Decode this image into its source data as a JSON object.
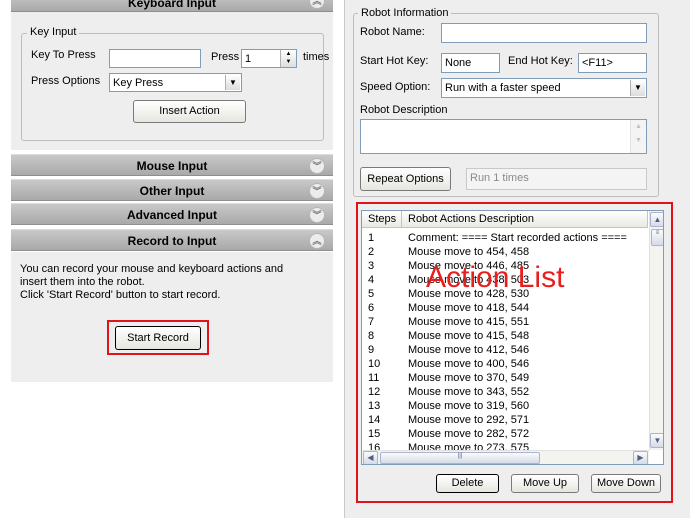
{
  "left": {
    "keyboard_header": "Keyboard Input",
    "key_input": {
      "legend": "Key Input",
      "key_to_press_label": "Key To Press",
      "key_to_press_value": "",
      "press_label": "Press",
      "press_value": "1",
      "times_label": "times",
      "press_options_label": "Press Options",
      "press_options_value": "Key Press",
      "insert_action_label": "Insert Action"
    },
    "mouse_header": "Mouse Input",
    "other_header": "Other Input",
    "advanced_header": "Advanced Input",
    "record_header": "Record to Input",
    "record_text_1": "You can record your mouse and keyboard actions and",
    "record_text_2": "insert them into the robot.",
    "record_text_3": "Click 'Start Record' button to start record.",
    "start_record_label": "Start Record"
  },
  "right": {
    "robot_info_legend": "Robot Information",
    "robot_name_label": "Robot Name:",
    "robot_name_value": "",
    "start_hot_key_label": "Start Hot Key:",
    "start_hot_key_value": "None",
    "end_hot_key_label": "End Hot Key:",
    "end_hot_key_value": "<F11>",
    "speed_option_label": "Speed Option:",
    "speed_option_value": "Run with a faster speed",
    "robot_description_label": "Robot Description",
    "robot_description_value": "",
    "repeat_options_label": "Repeat Options",
    "repeat_value": "Run 1 times"
  },
  "actions": {
    "overlay_label": "Action List",
    "col_steps": "Steps",
    "col_desc": "Robot Actions Description",
    "rows": [
      {
        "step": "1",
        "desc": "Comment: ==== Start recorded actions ===="
      },
      {
        "step": "2",
        "desc": "Mouse move to 454, 458"
      },
      {
        "step": "3",
        "desc": "Mouse move to 446, 485"
      },
      {
        "step": "4",
        "desc": "Mouse move to 438, 503"
      },
      {
        "step": "5",
        "desc": "Mouse move to 428, 530"
      },
      {
        "step": "6",
        "desc": "Mouse move to 418, 544"
      },
      {
        "step": "7",
        "desc": "Mouse move to 415, 551"
      },
      {
        "step": "8",
        "desc": "Mouse move to 415, 548"
      },
      {
        "step": "9",
        "desc": "Mouse move to 412, 546"
      },
      {
        "step": "10",
        "desc": "Mouse move to 400, 546"
      },
      {
        "step": "11",
        "desc": "Mouse move to 370, 549"
      },
      {
        "step": "12",
        "desc": "Mouse move to 343, 552"
      },
      {
        "step": "13",
        "desc": "Mouse move to 319, 560"
      },
      {
        "step": "14",
        "desc": "Mouse move to 292, 571"
      },
      {
        "step": "15",
        "desc": "Mouse move to 282, 572"
      },
      {
        "step": "16",
        "desc": "Mouse move to 273, 575"
      }
    ],
    "delete_label": "Delete",
    "move_up_label": "Move Up",
    "move_down_label": "Move Down"
  },
  "colors": {
    "highlight_red": "#e0121a",
    "header_gray": "#b5b5b5"
  }
}
